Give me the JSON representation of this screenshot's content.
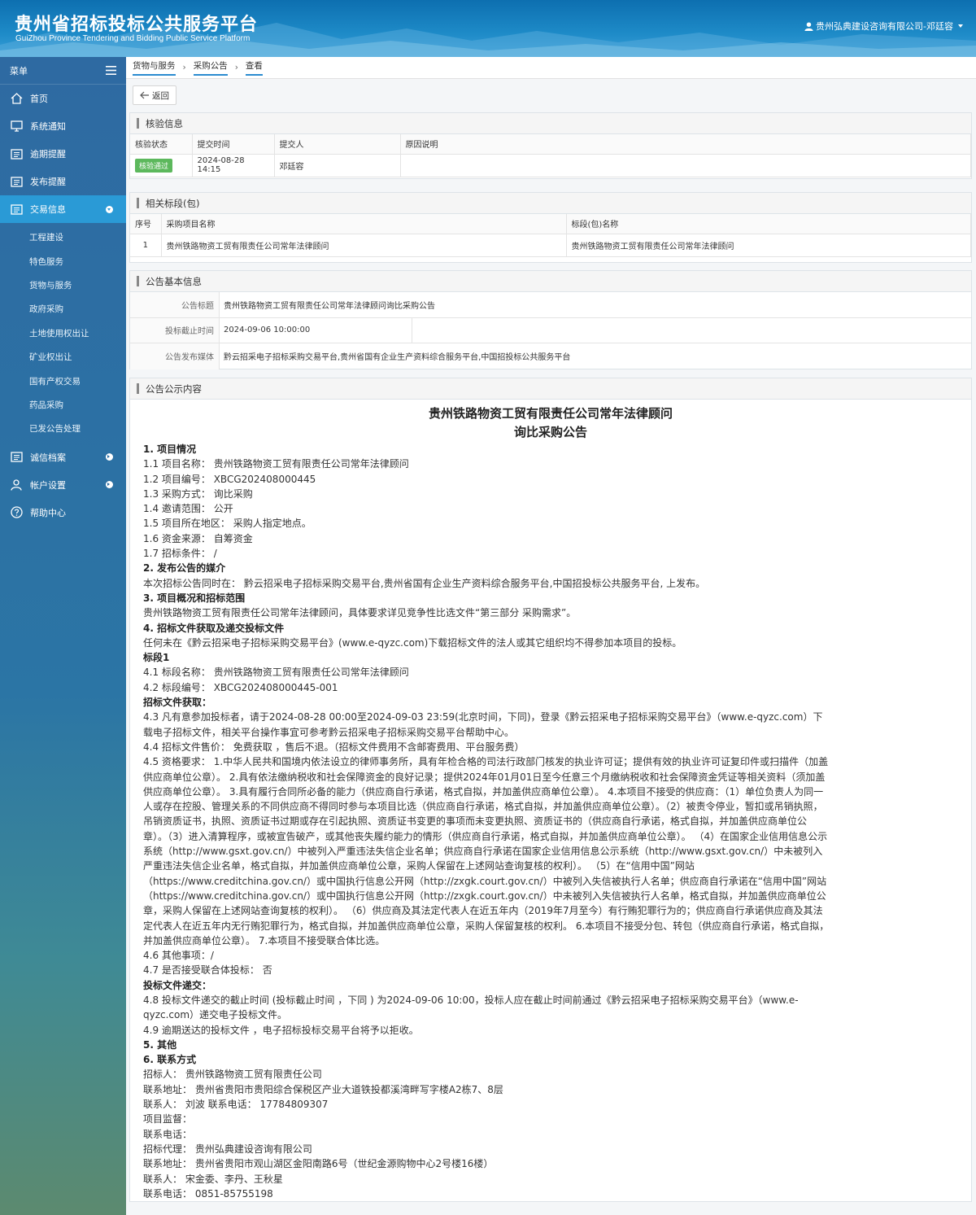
{
  "header": {
    "title": "贵州省招标投标公共服务平台",
    "subtitle": "GuiZhou Province Tendering and Bidding Public Service Platform",
    "user": "贵州弘典建设咨询有限公司-邓廷容"
  },
  "sidebar": {
    "menu_label": "菜单",
    "items": [
      {
        "label": "首页",
        "icon": "home-icon"
      },
      {
        "label": "系统通知",
        "icon": "monitor-icon"
      },
      {
        "label": "逾期提醒",
        "icon": "list-icon"
      },
      {
        "label": "发布提醒",
        "icon": "list-icon"
      },
      {
        "label": "交易信息",
        "icon": "list-icon"
      }
    ],
    "sub_items": [
      "工程建设",
      "特色服务",
      "货物与服务",
      "政府采购",
      "土地使用权出让",
      "矿业权出让",
      "国有产权交易",
      "药品采购",
      "已发公告处理"
    ],
    "bottom_items": [
      {
        "label": "诚信档案",
        "icon": "list-icon"
      },
      {
        "label": "帐户设置",
        "icon": "user-icon"
      },
      {
        "label": "帮助中心",
        "icon": "help-icon"
      }
    ]
  },
  "breadcrumb": [
    "货物与服务",
    "采购公告",
    "查看"
  ],
  "back_label": "返回",
  "verify": {
    "title": "核验信息",
    "headers": [
      "核验状态",
      "提交时间",
      "提交人",
      "原因说明"
    ],
    "status": "核验通过",
    "time": "2024-08-28 14:15",
    "person": "邓廷容",
    "reason": ""
  },
  "sections": {
    "title": "相关标段(包)",
    "headers": [
      "序号",
      "采购项目名称",
      "标段(包)名称"
    ],
    "rows": [
      [
        "1",
        "贵州铁路物资工贸有限责任公司常年法律顾问",
        "贵州铁路物资工贸有限责任公司常年法律顾问"
      ]
    ]
  },
  "basic": {
    "title": "公告基本信息",
    "rows": [
      {
        "label": "公告标题",
        "value": "贵州铁路物资工贸有限责任公司常年法律顾问询比采购公告"
      },
      {
        "label": "投标截止时间",
        "value": "2024-09-06 10:00:00"
      },
      {
        "label": "公告发布媒体",
        "value": "黔云招采电子招标采购交易平台,贵州省国有企业生产资料综合服务平台,中国招投标公共服务平台"
      }
    ]
  },
  "notice": {
    "title": "公告公示内容",
    "heading1": "贵州铁路物资工贸有限责任公司常年法律顾问",
    "heading2": "询比采购公告",
    "lines": [
      {
        "b": true,
        "t": "1. 项目情况"
      },
      {
        "t": "1.1 项目名称： 贵州铁路物资工贸有限责任公司常年法律顾问"
      },
      {
        "t": "1.2 项目编号： XBCG202408000445"
      },
      {
        "t": "1.3 采购方式： 询比采购"
      },
      {
        "t": "1.4 邀请范围： 公开"
      },
      {
        "t": "1.5 项目所在地区： 采购人指定地点。"
      },
      {
        "t": "1.6 资金来源： 自筹资金"
      },
      {
        "t": "1.7 招标条件： /"
      },
      {
        "b": true,
        "t": "2. 发布公告的媒介"
      },
      {
        "t": "本次招标公告同时在： 黔云招采电子招标采购交易平台,贵州省国有企业生产资料综合服务平台,中国招投标公共服务平台, 上发布。"
      },
      {
        "b": true,
        "t": "3. 项目概况和招标范围"
      },
      {
        "t": "贵州铁路物资工贸有限责任公司常年法律顾问，具体要求详见竞争性比选文件“第三部分 采购需求”。"
      },
      {
        "b": true,
        "t": "4. 招标文件获取及递交投标文件"
      },
      {
        "t": "任何未在《黔云招采电子招标采购交易平台》(www.e-qyzc.com)下载招标文件的法人或其它组织均不得参加本项目的投标。"
      },
      {
        "b": true,
        "t": "标段1"
      },
      {
        "t": "4.1 标段名称： 贵州铁路物资工贸有限责任公司常年法律顾问"
      },
      {
        "t": "4.2 标段编号： XBCG202408000445-001"
      },
      {
        "b": true,
        "t": "招标文件获取："
      },
      {
        "t": "4.3 凡有意参加投标者，请于2024-08-28 00:00至2024-09-03 23:59(北京时间，下同)，登录《黔云招采电子招标采购交易平台》（www.e-qyzc.com）下载电子招标文件，相关平台操作事宜可参考黔云招采电子招标采购交易平台帮助中心。"
      },
      {
        "t": "4.4 招标文件售价： 免费获取 ，售后不退。（招标文件费用不含邮寄费用、平台服务费）"
      },
      {
        "t": "4.5 资格要求： 1.中华人民共和国境内依法设立的律师事务所，具有年检合格的司法行政部门核发的执业许可证；提供有效的执业许可证复印件或扫描件（加盖供应商单位公章）。 2.具有依法缴纳税收和社会保障资金的良好记录；提供2024年01月01日至今任意三个月缴纳税收和社会保障资金凭证等相关资料（须加盖供应商单位公章）。 3.具有履行合同所必备的能力（供应商自行承诺，格式自拟，并加盖供应商单位公章）。 4.本项目不接受的供应商：（1）单位负责人为同一人或存在控股、管理关系的不同供应商不得同时参与本项目比选（供应商自行承诺，格式自拟，并加盖供应商单位公章）。（2）被责令停业，暂扣或吊销执照，吊销资质证书，执照、资质证书过期或存在引起执照、资质证书变更的事项而未变更执照、资质证书的（供应商自行承诺，格式自拟，并加盖供应商单位公章）。（3）进入清算程序，或被宣告破产，或其他丧失履约能力的情形（供应商自行承诺，格式自拟，并加盖供应商单位公章）。 （4）在国家企业信用信息公示系统（http://www.gsxt.gov.cn/）中被列入严重违法失信企业名单；供应商自行承诺在国家企业信用信息公示系统（http://www.gsxt.gov.cn/）中未被列入严重违法失信企业名单，格式自拟，并加盖供应商单位公章，采购人保留在上述网站查询复核的权利）。 （5）在“信用中国”网站（https://www.creditchina.gov.cn/）或中国执行信息公开网（http://zxgk.court.gov.cn/）中被列入失信被执行人名单；供应商自行承诺在“信用中国”网站（https://www.creditchina.gov.cn/）或中国执行信息公开网（http://zxgk.court.gov.cn/）中未被列入失信被执行人名单，格式自拟，并加盖供应商单位公章，采购人保留在上述网站查询复核的权利）。 （6）供应商及其法定代表人在近五年内（2019年7月至今）有行贿犯罪行为的；供应商自行承诺供应商及其法定代表人在近五年内无行贿犯罪行为，格式自拟，并加盖供应商单位公章，采购人保留复核的权利。 6.本项目不接受分包、转包（供应商自行承诺，格式自拟，并加盖供应商单位公章）。 7.本项目不接受联合体比选。"
      },
      {
        "t": "4.6 其他事项：/"
      },
      {
        "t": "4.7 是否接受联合体投标： 否"
      },
      {
        "b": true,
        "t": "投标文件递交："
      },
      {
        "t": "4.8 投标文件递交的截止时间 (投标截止时间 ，下同 ) 为2024-09-06 10:00，投标人应在截止时间前通过《黔云招采电子招标采购交易平台》（www.e-qyzc.com）递交电子投标文件。"
      },
      {
        "t": "4.9 逾期送达的投标文件 ，电子招标投标交易平台将予以拒收。"
      },
      {
        "b": true,
        "t": "5. 其他"
      },
      {
        "b": true,
        "t": "6. 联系方式"
      },
      {
        "t": "招标人： 贵州铁路物资工贸有限责任公司"
      },
      {
        "t": "联系地址： 贵州省贵阳市贵阳综合保税区产业大道铁投都溪湾畔写字楼A2栋7、8层"
      },
      {
        "t": "联系人： 刘波 联系电话： 17784809307"
      },
      {
        "t": "项目监督："
      },
      {
        "t": "联系电话："
      },
      {
        "t": "招标代理： 贵州弘典建设咨询有限公司"
      },
      {
        "t": "联系地址： 贵州省贵阳市观山湖区金阳南路6号（世纪金源购物中心2号楼16楼）"
      },
      {
        "t": "联系人： 宋金委、李丹、王秋星"
      },
      {
        "t": "联系电话： 0851-85755198"
      }
    ]
  }
}
